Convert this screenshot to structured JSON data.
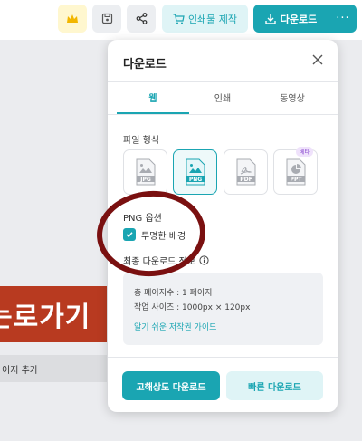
{
  "toolbar": {
    "print_label": "인쇄물 제작",
    "download_label": "다운로드",
    "more_label": "···"
  },
  "canvas": {
    "banner_text": "는로가기",
    "add_page_text": "이지 추가"
  },
  "panel": {
    "title": "다운로드",
    "tabs": [
      {
        "label": "웹",
        "active": true
      },
      {
        "label": "인쇄",
        "active": false
      },
      {
        "label": "동영상",
        "active": false
      }
    ],
    "file_format_label": "파일 형식",
    "formats": [
      {
        "label": "JPG",
        "selected": false,
        "icon": "image-file-icon"
      },
      {
        "label": "PNG",
        "selected": true,
        "icon": "image-file-icon"
      },
      {
        "label": "PDF",
        "selected": false,
        "icon": "pdf-file-icon"
      },
      {
        "label": "PPT",
        "selected": false,
        "icon": "ppt-file-icon",
        "badge": "베타"
      }
    ],
    "png_options_label": "PNG 옵션",
    "transparent_bg_label": "투명한 배경",
    "transparent_bg_checked": true,
    "final_info_label": "최종 다운로드 정보",
    "info": {
      "pages": "총 페이지수 : 1 페이지",
      "size": "작업 사이즈 : 1000px × 120px",
      "copyright_link": "알기 쉬운 저작권 가이드"
    },
    "hires_button": "고해상도 다운로드",
    "fast_button": "빠른 다운로드"
  },
  "colors": {
    "accent": "#1aa5b2",
    "annotation": "#7a1010"
  }
}
